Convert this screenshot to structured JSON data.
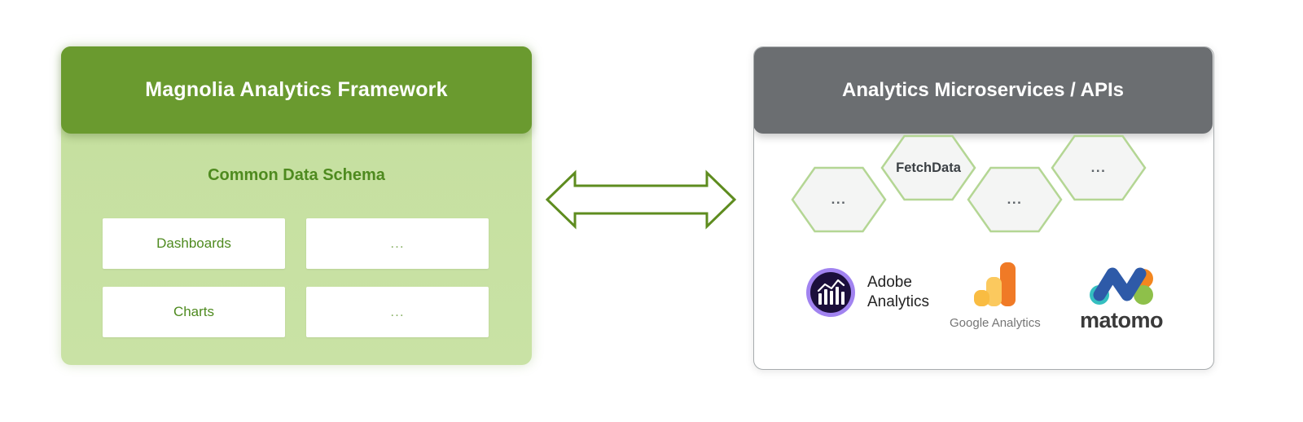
{
  "diagram": {
    "title_left": "Magnolia Analytics Framework",
    "title_right": "Analytics Microservices / APIs",
    "connector": {
      "icon": "double-arrow-icon",
      "direction": "bidirectional",
      "color": "#5e8c1f"
    },
    "colors": {
      "left_header_bg": "#6a9a2f",
      "left_body_bg": "#c9e2a5",
      "left_text": "#4e8a1f",
      "right_header_bg": "#6b6e71",
      "right_panel_border": "#a8acae",
      "hex_border": "#b4d694",
      "hex_fill": "#f4f5f4",
      "hex_text": "#3b4044"
    }
  },
  "left": {
    "header_title": "Magnolia Analytics Framework",
    "section_label": "Common Data Schema",
    "tiles": [
      {
        "label": "Dashboards",
        "muted": false
      },
      {
        "label": "...",
        "muted": true
      },
      {
        "label": "Charts",
        "muted": false
      },
      {
        "label": "...",
        "muted": true
      }
    ]
  },
  "right": {
    "header_title": "Analytics Microservices / APIs",
    "hexagons": [
      {
        "label": "...",
        "muted": true
      },
      {
        "label": "FetchData",
        "muted": false
      },
      {
        "label": "...",
        "muted": true
      },
      {
        "label": "...",
        "muted": true
      }
    ],
    "logos": [
      {
        "name": "Adobe Analytics",
        "line1": "Adobe",
        "line2": "Analytics",
        "mark_colors": {
          "ring": "#a183f0",
          "disc": "#1b0f3b",
          "bars": "#ffffff"
        }
      },
      {
        "name": "Google Analytics",
        "caption": "Google Analytics",
        "mark_colors": {
          "light": "#f9bc42",
          "mid": "#fbc95e",
          "dark": "#f07a26"
        }
      },
      {
        "name": "matomo",
        "caption": "matomo",
        "mark_colors": {
          "blue": "#2e5aa8",
          "orange": "#f3861f",
          "green": "#8ec04a",
          "teal": "#35bfc0"
        }
      }
    ]
  }
}
